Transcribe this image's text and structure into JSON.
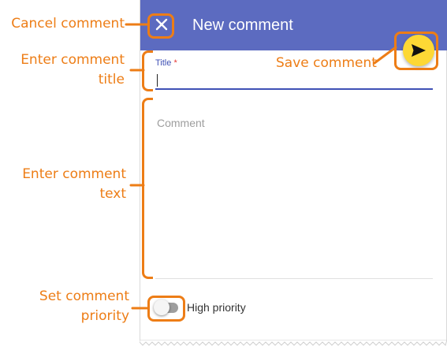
{
  "dialog": {
    "title": "New comment"
  },
  "form": {
    "title_field": {
      "label": "Title",
      "required_marker": "*",
      "value": ""
    },
    "comment_field": {
      "placeholder": "Comment",
      "value": ""
    },
    "priority_toggle": {
      "label": "High priority",
      "checked": false
    }
  },
  "annotations": {
    "cancel": "Cancel comment",
    "title_line1": "Enter comment",
    "title_line2": "title",
    "save": "Save comment",
    "text_line1": "Enter comment",
    "text_line2": "text",
    "priority_line1": "Set comment",
    "priority_line2": "priority"
  },
  "icons": {
    "close": "close-icon",
    "send": "send-icon"
  },
  "colors": {
    "header": "#5c6bc0",
    "fab": "#fdd835",
    "focus": "#3f51b5",
    "annotation": "#ed7d16",
    "required": "#e53935"
  }
}
